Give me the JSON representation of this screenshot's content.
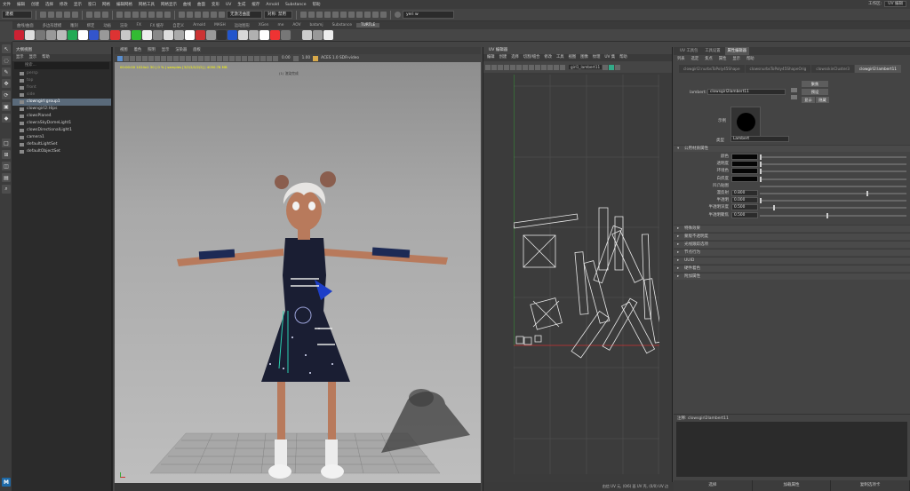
{
  "menubar": {
    "items": [
      "文件",
      "编辑",
      "创建",
      "选择",
      "修改",
      "显示",
      "窗口",
      "网格",
      "编辑网格",
      "网格工具",
      "网格显示",
      "曲线",
      "曲面",
      "变形",
      "UV",
      "生成",
      "缓存",
      "Arnold",
      "Substance",
      "帮助"
    ],
    "workspace_label": "工作区:",
    "workspace_value": "UV 编辑"
  },
  "toolline": {
    "mode_select": "建模",
    "snap_field": "无激活曲面",
    "symmetry": "对称: 禁用",
    "user": "yeri w"
  },
  "shelf": {
    "tabs": [
      "曲线/曲面",
      "多边形建模",
      "雕刻",
      "绑定",
      "动画",
      "渲染",
      "FX",
      "FX 缓存",
      "自定义",
      "Arnold",
      "MASH",
      "运动图形",
      "XGen",
      "me",
      "AOV",
      "batamj",
      "Substance",
      "TURTLE"
    ],
    "active_tab": "TURTLE"
  },
  "outliner": {
    "title": "大纲视图",
    "menu": [
      "显示",
      "显示",
      "帮助"
    ],
    "search_placeholder": "搜索...",
    "items": [
      {
        "label": "persp",
        "dim": true
      },
      {
        "label": "top",
        "dim": true
      },
      {
        "label": "front",
        "dim": true
      },
      {
        "label": "side",
        "dim": true
      },
      {
        "label": "clowngirl:group1",
        "selected": true
      },
      {
        "label": "clowngirl2:Hips"
      },
      {
        "label": "clowsPlane4"
      },
      {
        "label": "clowraSkyDomeLight1"
      },
      {
        "label": "clowsDirectionalLight1"
      },
      {
        "label": "camera1"
      },
      {
        "label": "defaultLightSet"
      },
      {
        "label": "defaultObjectSet"
      }
    ]
  },
  "viewport": {
    "menu": [
      "视图",
      "着色",
      "照明",
      "显示",
      "渲染器",
      "面板"
    ],
    "exposure": "0.00",
    "gamma": "1.00",
    "colorspace": "ACES 1.0 SDR-video",
    "hud_text": "00:00:00  1024x1 30  | 0 % |  samples [3/2/2/2/2/2]  | 4050.78 MB",
    "hud_sub": "(1) 渲染完成"
  },
  "uv_editor": {
    "title": "UV 编辑器",
    "menu": [
      "编辑",
      "创建",
      "选择",
      "切割/缝合",
      "修改",
      "工具",
      "视图",
      "图像",
      "纹理",
      "UV 集",
      "帮助"
    ],
    "uv_set": "girl1_lambert11",
    "status": "由信 UV 元, (0/6) 面 UV 壳, (0/0) UV 边"
  },
  "attribute_editor": {
    "top_tabs": [
      "UV 工具包",
      "工具设置",
      "属性编辑器"
    ],
    "active_top_tab": "属性编辑器",
    "menu": [
      "列表",
      "选定",
      "焦点",
      "属性",
      "显示",
      "帮助"
    ],
    "node_tabs": [
      "clowgirl2:nurbsToPoly45Shape",
      "clowsnurbsToPoly45ShapeOrig",
      "clowsskinCluster3",
      "clowgirl2:lambert11"
    ],
    "active_node_tab": "clowgirl2:lambert11",
    "node_label": "lambert:",
    "node_value": "clowsgirl2lambert11",
    "buttons": [
      "聚焦",
      "预设",
      "显示",
      "隐藏"
    ],
    "sample_label": "示例",
    "type_label": "类型",
    "type_value": "Lambert",
    "common_section": "公用材质属性",
    "attrs": [
      {
        "label": "颜色",
        "kind": "swatch"
      },
      {
        "label": "透明度",
        "kind": "swatch"
      },
      {
        "label": "环境色",
        "kind": "swatch"
      },
      {
        "label": "白炽度",
        "kind": "swatch"
      },
      {
        "label": "凹凸贴图",
        "kind": "empty"
      },
      {
        "label": "漫反射",
        "kind": "num",
        "value": "0.800",
        "level": 0.8
      },
      {
        "label": "半透明",
        "kind": "num",
        "value": "0.000",
        "level": 0.0
      },
      {
        "label": "半透明深度",
        "kind": "num",
        "value": "0.500",
        "level": 0.1
      },
      {
        "label": "半透明聚焦",
        "kind": "num",
        "value": "0.500",
        "level": 0.5
      }
    ],
    "sections": [
      "特殊效果",
      "蒙版不透明度",
      "光线跟踪选项",
      "节点行为",
      "UUID",
      "硬件着色",
      "附加属性"
    ],
    "notes_label": "注释: clowsgirl2lambert11",
    "bottom_buttons": [
      "选择",
      "加载属性",
      "复制选项卡"
    ]
  }
}
